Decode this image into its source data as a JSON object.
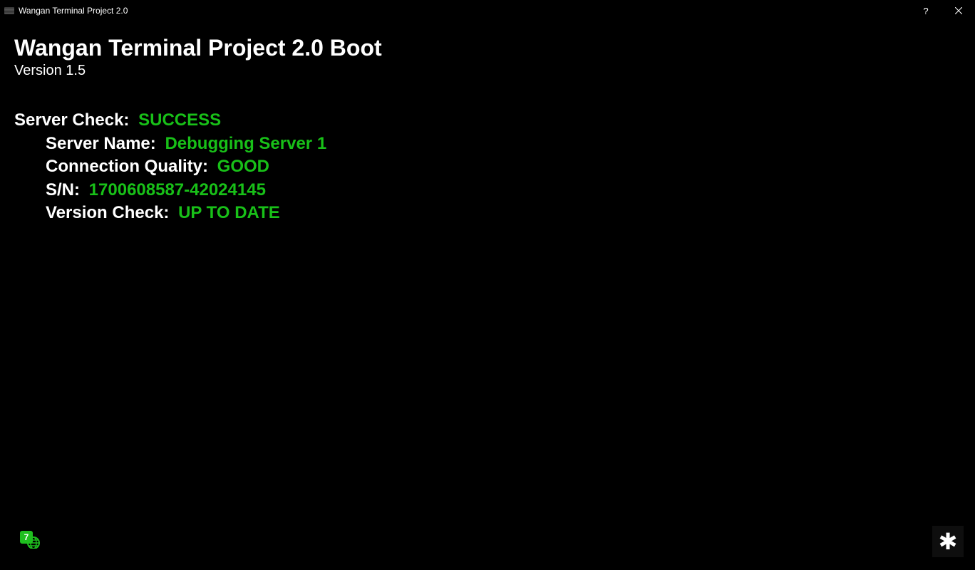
{
  "window": {
    "title": "Wangan Terminal Project 2.0"
  },
  "header": {
    "title": "Wangan Terminal Project 2.0 Boot",
    "version": "Version 1.5"
  },
  "server_check": {
    "label": "Server Check:",
    "value": "SUCCESS",
    "fields": [
      {
        "label": "Server Name:",
        "value": "Debugging Server 1"
      },
      {
        "label": "Connection Quality:",
        "value": "GOOD"
      },
      {
        "label": "S/N:",
        "value": "1700608587-42024145"
      },
      {
        "label": "Version Check:",
        "value": "UP TO DATE"
      }
    ]
  },
  "icons": {
    "bottom_right_glyph": "✱"
  },
  "colors": {
    "success": "#18c018",
    "background": "#000000",
    "foreground": "#ffffff"
  }
}
